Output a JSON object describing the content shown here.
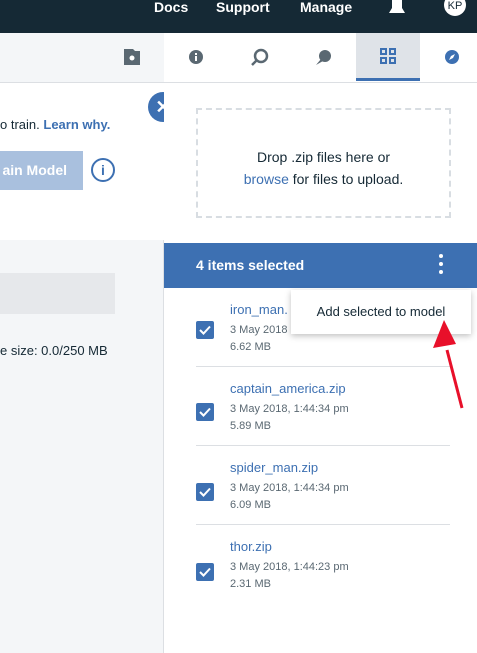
{
  "topnav": {
    "docs": "Docs",
    "support": "Support",
    "manage": "Manage",
    "avatar": "KP"
  },
  "left": {
    "train_text": "o train.",
    "learn_why": "Learn why.",
    "train_button": "ain Model",
    "info_glyph": "i",
    "size_text": "e size: 0.0/250 MB",
    "close_glyph": "✕"
  },
  "dropzone": {
    "line1": "Drop .zip files here or",
    "browse": "browse",
    "line2_rest": " for files to upload."
  },
  "selection": {
    "count": "4 items selected"
  },
  "menu": {
    "add_selected": "Add selected to model"
  },
  "items": [
    {
      "name": "iron_man.",
      "date": "3 May 2018",
      "size": "6.62 MB"
    },
    {
      "name": "captain_america.zip",
      "date": "3 May 2018, 1:44:34 pm",
      "size": "5.89 MB"
    },
    {
      "name": "spider_man.zip",
      "date": "3 May 2018, 1:44:34 pm",
      "size": "6.09 MB"
    },
    {
      "name": "thor.zip",
      "date": "3 May 2018, 1:44:23 pm",
      "size": "2.31 MB"
    }
  ],
  "colors": {
    "accent": "#3d70b2",
    "topbar": "#152935",
    "annotation_arrow": "#e8102a"
  }
}
